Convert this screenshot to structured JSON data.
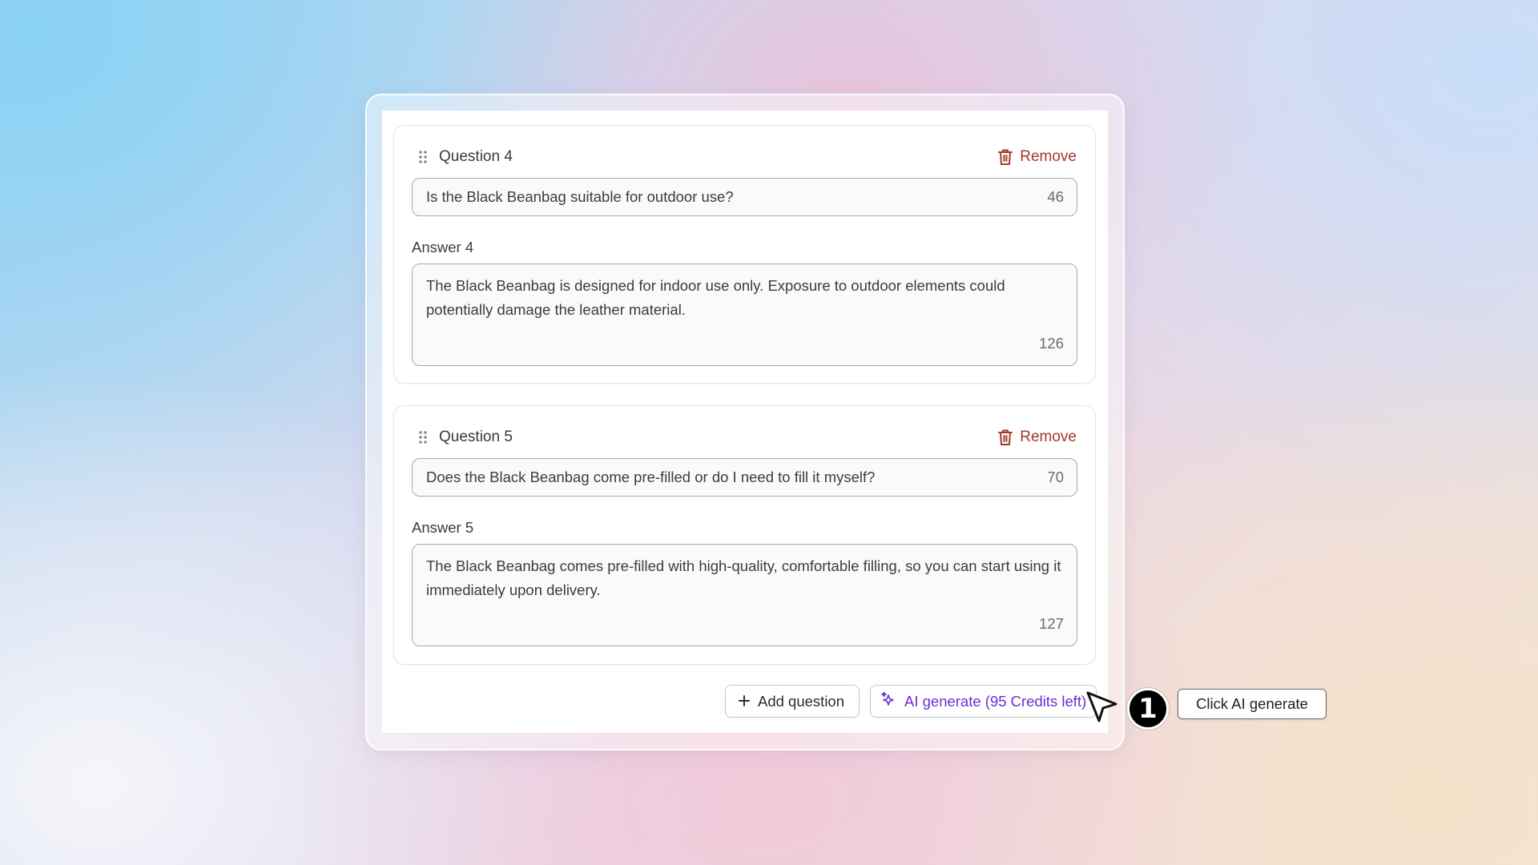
{
  "faq": {
    "items": [
      {
        "question_label": "Question 4",
        "remove_label": "Remove",
        "question_value": "Is the Black Beanbag suitable for outdoor use?",
        "question_count": "46",
        "answer_label": "Answer 4",
        "answer_value": "The Black Beanbag is designed for indoor use only. Exposure to outdoor elements could potentially damage the leather material.",
        "answer_count": "126"
      },
      {
        "question_label": "Question 5",
        "remove_label": "Remove",
        "question_value": "Does the Black Beanbag come pre-filled or do I need to fill it myself?",
        "question_count": "70",
        "answer_label": "Answer 5",
        "answer_value": "The Black Beanbag comes pre-filled with high-quality, comfortable filling, so you can start using it immediately upon delivery.",
        "answer_count": "127"
      }
    ]
  },
  "actions": {
    "add_question_label": "Add question",
    "ai_generate_label": "AI generate (95 Credits left)"
  },
  "annotation": {
    "step_number": "1",
    "tooltip_text": "Click AI generate"
  },
  "icons": {
    "drag": "drag-handle-icon",
    "remove": "trash-icon",
    "add": "plus-icon",
    "ai": "sparkle-icon",
    "pointer": "cursor-arrow-icon"
  },
  "colors": {
    "remove": "#a33a2a",
    "ai_accent": "#6b2fd6",
    "border": "#a9a9ad"
  }
}
